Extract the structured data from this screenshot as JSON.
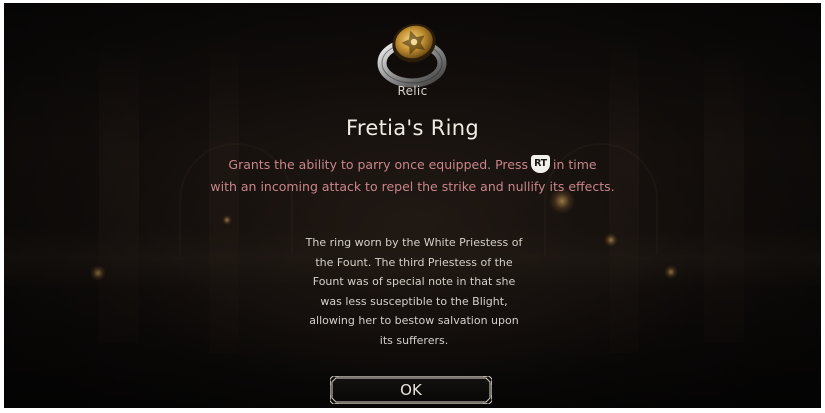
{
  "item": {
    "category": "Relic",
    "name": "Fretia's Ring",
    "effect_line1_before": "Grants the ability to parry once equipped.  Press",
    "button_prompt": "RT",
    "effect_line1_after": "in time",
    "effect_line2": "with an incoming attack to repel the strike and nullify its effects.",
    "lore_lines": [
      "The ring worn by the White Priestess of",
      "the Fount. The third Priestess of the",
      "Fount was of special note in that she",
      "was less susceptible to the Blight,",
      "allowing her to bestow salvation upon",
      "its sufferers."
    ]
  },
  "dialog": {
    "ok_label": "OK"
  },
  "icons": {
    "item": "ring-icon",
    "prompt": "rt-button-icon"
  },
  "colors": {
    "effect_text": "#c9858a",
    "lore_text": "#d4d0c9",
    "title_text": "#f0ece4"
  }
}
